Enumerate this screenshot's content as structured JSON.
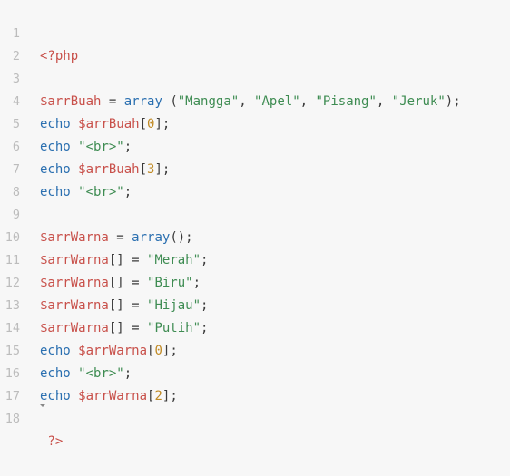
{
  "editor": {
    "line_numbers": [
      "1",
      "2",
      "3",
      "4",
      "5",
      "6",
      "7",
      "8",
      "9",
      "10",
      "11",
      "12",
      "13",
      "14",
      "15",
      "16",
      "17",
      "18"
    ],
    "colors": {
      "background": "#f7f7f7",
      "keyword": "#2a6fb0",
      "variable": "#c8504a",
      "string": "#3e8c52",
      "number": "#c08a25",
      "line_number": "#bcbcbc"
    },
    "tokens": {
      "l1": {
        "open_tag": "<?php"
      },
      "l3": {
        "var": "$arrBuah",
        "eq": " = ",
        "fn": "array",
        "p1": " (",
        "s1": "\"Mangga\"",
        "c1": ", ",
        "s2": "\"Apel\"",
        "c2": ", ",
        "s3": "\"Pisang\"",
        "c3": ", ",
        "s4": "\"Jeruk\"",
        "end": ");"
      },
      "l4": {
        "kw": "echo",
        "sp": " ",
        "var": "$arrBuah",
        "lb": "[",
        "num": "0",
        "end": "];"
      },
      "l5": {
        "kw": "echo",
        "sp": " ",
        "str": "\"<br>\"",
        "end": ";"
      },
      "l6": {
        "kw": "echo",
        "sp": " ",
        "var": "$arrBuah",
        "lb": "[",
        "num": "3",
        "end": "];"
      },
      "l7": {
        "kw": "echo",
        "sp": " ",
        "str": "\"<br>\"",
        "end": ";"
      },
      "l9": {
        "var": "$arrWarna",
        "eq": " = ",
        "fn": "array",
        "end": "();"
      },
      "l10": {
        "var": "$arrWarna",
        "br": "[]",
        "eq": " = ",
        "str": "\"Merah\"",
        "end": ";"
      },
      "l11": {
        "var": "$arrWarna",
        "br": "[]",
        "eq": " = ",
        "str": "\"Biru\"",
        "end": ";"
      },
      "l12": {
        "var": "$arrWarna",
        "br": "[]",
        "eq": " = ",
        "str": "\"Hijau\"",
        "end": ";"
      },
      "l13": {
        "var": "$arrWarna",
        "br": "[]",
        "eq": " = ",
        "str": "\"Putih\"",
        "end": ";"
      },
      "l14": {
        "kw": "echo",
        "sp": " ",
        "var": "$arrWarna",
        "lb": "[",
        "num": "0",
        "end": "];"
      },
      "l15": {
        "kw": "echo",
        "sp": " ",
        "str": "\"<br>\"",
        "end": ";"
      },
      "l16": {
        "kw": "echo",
        "sp": " ",
        "var": "$arrWarna",
        "lb": "[",
        "num": "2",
        "end": "];"
      },
      "l18": {
        "close_tag": " ?>"
      }
    }
  }
}
